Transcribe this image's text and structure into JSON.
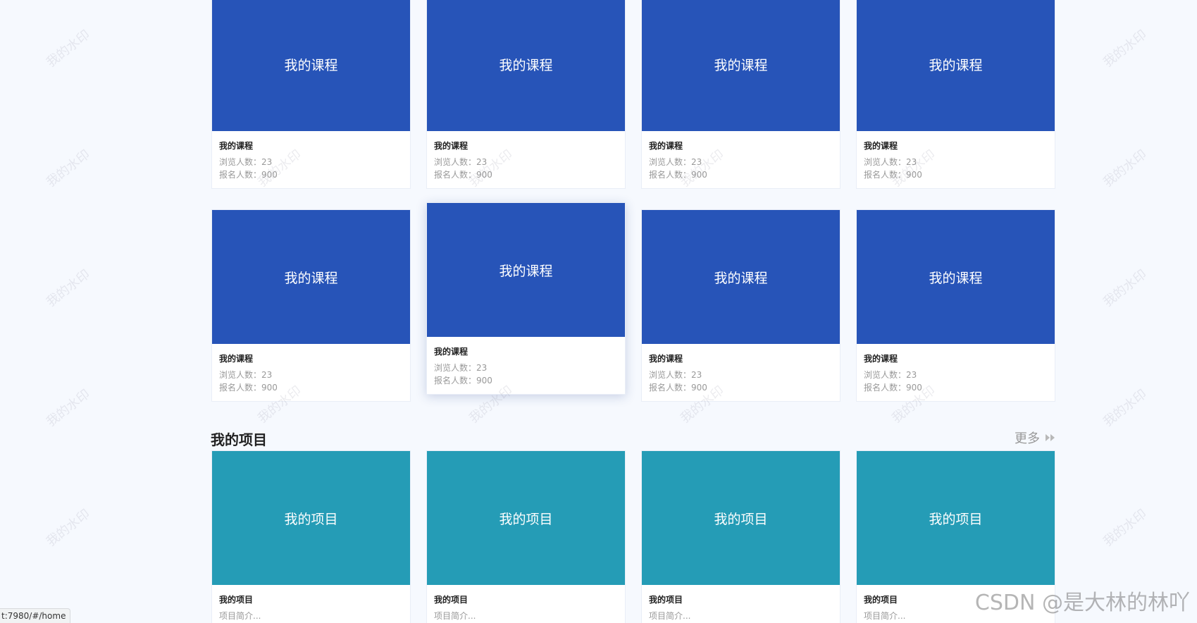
{
  "courses": [
    {
      "cover_text": "我的课程",
      "title": "我的课程",
      "views": "浏览人数：23",
      "signups": "报名人数：900"
    },
    {
      "cover_text": "我的课程",
      "title": "我的课程",
      "views": "浏览人数：23",
      "signups": "报名人数：900"
    },
    {
      "cover_text": "我的课程",
      "title": "我的课程",
      "views": "浏览人数：23",
      "signups": "报名人数：900"
    },
    {
      "cover_text": "我的课程",
      "title": "我的课程",
      "views": "浏览人数：23",
      "signups": "报名人数：900"
    },
    {
      "cover_text": "我的课程",
      "title": "我的课程",
      "views": "浏览人数：23",
      "signups": "报名人数：900"
    },
    {
      "cover_text": "我的课程",
      "title": "我的课程",
      "views": "浏览人数：23",
      "signups": "报名人数：900"
    },
    {
      "cover_text": "我的课程",
      "title": "我的课程",
      "views": "浏览人数：23",
      "signups": "报名人数：900"
    },
    {
      "cover_text": "我的课程",
      "title": "我的课程",
      "views": "浏览人数：23",
      "signups": "报名人数：900"
    }
  ],
  "projects_section": {
    "title": "我的项目",
    "more_label": "更多",
    "more_icon": "double-chevron-right-icon"
  },
  "projects": [
    {
      "cover_text": "我的项目",
      "title": "我的项目",
      "desc": "项目简介..."
    },
    {
      "cover_text": "我的项目",
      "title": "我的项目",
      "desc": "项目简介..."
    },
    {
      "cover_text": "我的项目",
      "title": "我的项目",
      "desc": "项目简介..."
    },
    {
      "cover_text": "我的项目",
      "title": "我的项目",
      "desc": "项目简介..."
    }
  ],
  "watermark_text": "我的水印",
  "status_bar_url": "t:7980/#/home",
  "csdn_watermark": "CSDN @是大林的林吖",
  "colors": {
    "course_cover": "#2754b8",
    "project_cover": "#259cb6",
    "page_background": "#f6f9fe"
  }
}
